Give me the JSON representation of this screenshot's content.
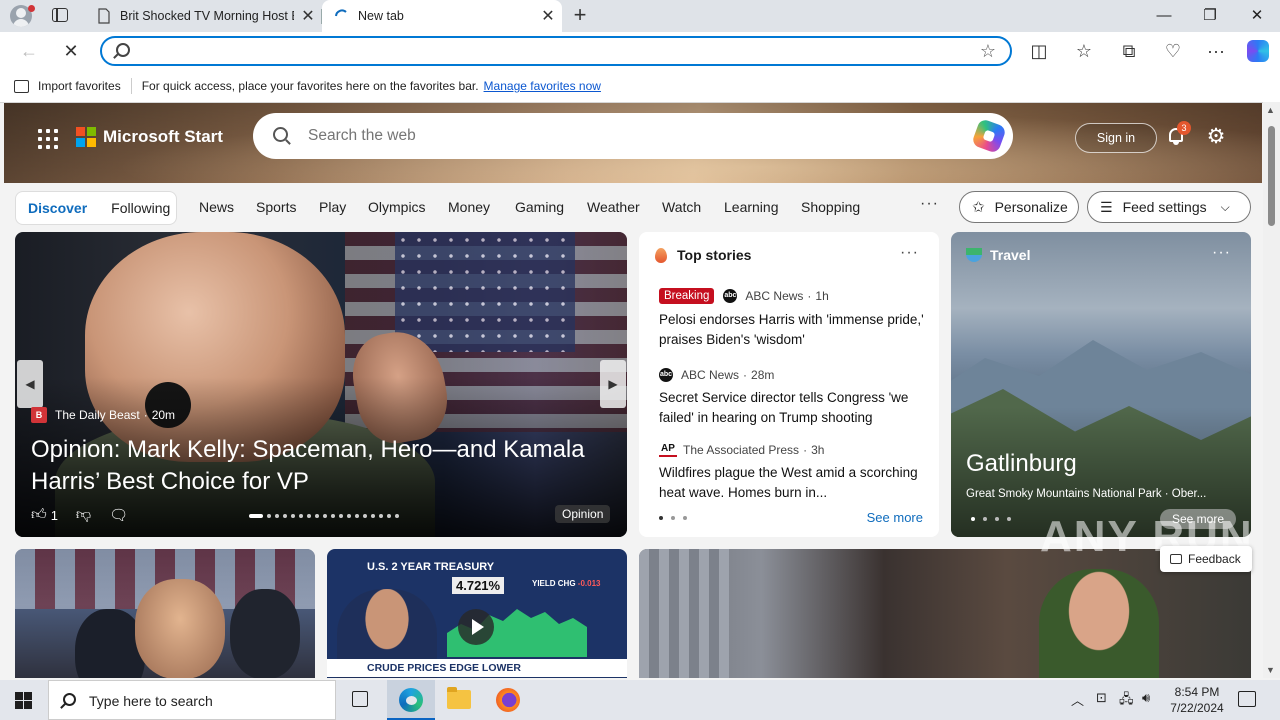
{
  "browser": {
    "tabs": [
      {
        "title": "Brit Shocked TV Morning Host By"
      },
      {
        "title": "New tab"
      }
    ],
    "address": {
      "value": "",
      "placeholder": ""
    },
    "favorites_bar": {
      "import_label": "Import favorites",
      "message": "For quick access, place your favorites here on the favorites bar.",
      "link": "Manage favorites now"
    }
  },
  "msstart": {
    "brand": "Microsoft Start",
    "search_placeholder": "Search the web",
    "signin": "Sign in",
    "notification_count": "3",
    "pill": [
      "Discover",
      "Following"
    ],
    "nav": [
      "News",
      "Sports",
      "Play",
      "Olympics",
      "Money",
      "Gaming",
      "Weather",
      "Watch",
      "Learning",
      "Shopping"
    ],
    "nav_more": "···",
    "personalize": "Personalize",
    "feed_settings": "Feed settings"
  },
  "feature": {
    "source": "The Daily Beast",
    "age": "20m",
    "title": "Opinion: Mark Kelly: Spaceman, Hero—and Kamala Harris’ Best Choice for VP",
    "likes": "1",
    "tag": "Opinion"
  },
  "top_stories": {
    "header": "Top stories",
    "more": "···",
    "stories": [
      {
        "badge": "Breaking",
        "source": "ABC News",
        "age": "1h",
        "title": "Pelosi endorses Harris with 'immense pride,' praises Biden's 'wisdom'"
      },
      {
        "badge": "",
        "source": "ABC News",
        "age": "28m",
        "title": "Secret Service director tells Congress 'we failed' in hearing on Trump shooting"
      },
      {
        "badge": "",
        "source": "The Associated Press",
        "age": "3h",
        "title": "Wildfires plague the West amid a scorching heat wave. Homes burn in..."
      }
    ],
    "see_more": "See more"
  },
  "travel": {
    "header": "Travel",
    "more": "···",
    "title": "Gatlinburg",
    "subtitle": "Great Smoky Mountains National Park · Ober...",
    "see_more": "See more"
  },
  "thumb2": {
    "banner": "U.S. 2 YEAR TREASURY",
    "value": "4.721%",
    "yield_label": "YIELD CHG",
    "yield_change": "-0.013",
    "ticker": "CRUDE PRICES EDGE LOWER"
  },
  "watermark": "ANY RUN",
  "feedback": "Feedback",
  "taskbar": {
    "search_placeholder": "Type here to search",
    "time": "8:54 PM",
    "date": "7/22/2024"
  }
}
